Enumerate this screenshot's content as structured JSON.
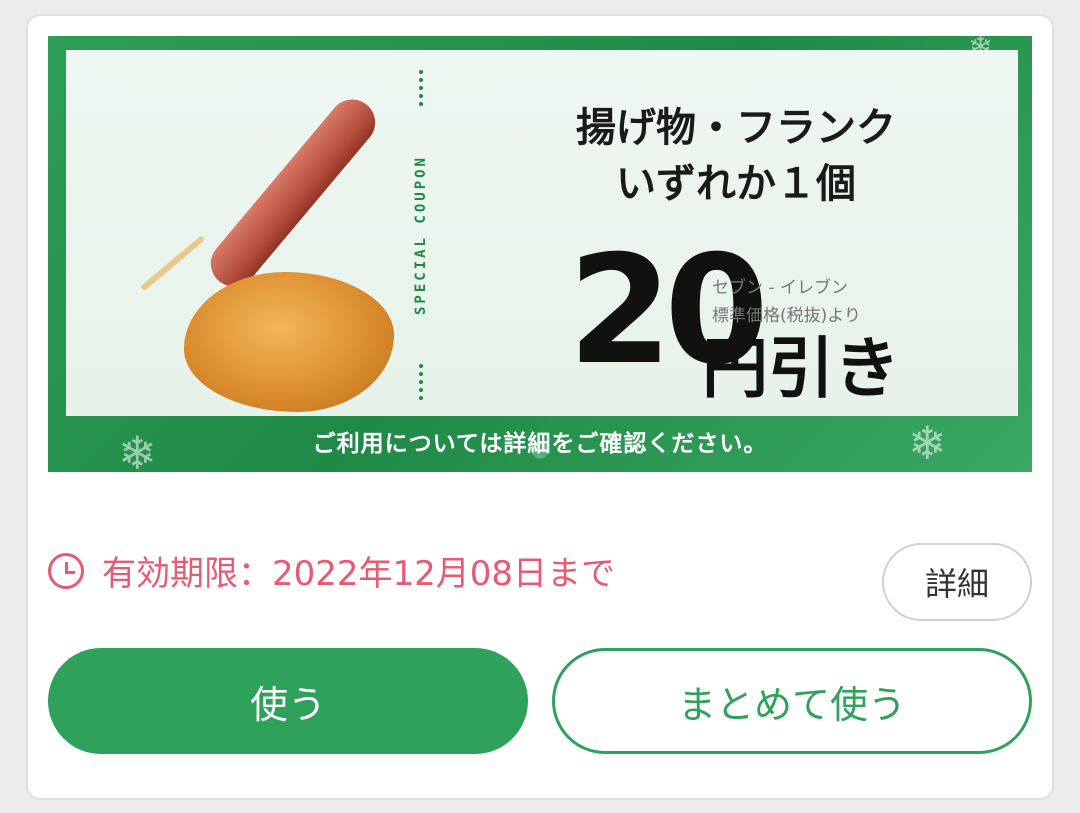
{
  "coupon": {
    "vertical_label": "SPECIAL COUPON",
    "headline_line1": "揚げ物・フランク",
    "headline_line2": "いずれか１個",
    "price_number": "20",
    "price_note_line1": "セブン - イレブン",
    "price_note_line2": "標準価格(税抜)より",
    "price_suffix": "円引き",
    "footer_note": "ご利用については詳細をご確認ください。"
  },
  "expiry": {
    "icon": "clock-icon",
    "text": "有効期限：2022年12月08日まで"
  },
  "buttons": {
    "details_label": "詳細",
    "use_label": "使う",
    "use_batch_label": "まとめて使う"
  },
  "colors": {
    "accent_green": "#2ea25a",
    "expiry_pink": "#e65a73"
  }
}
